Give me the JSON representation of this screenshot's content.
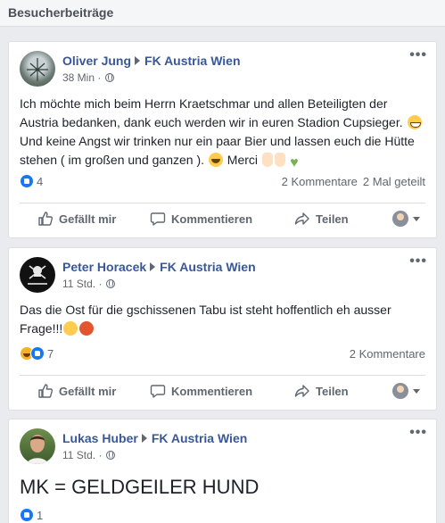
{
  "section": {
    "title": "Besucherbeiträge"
  },
  "labels": {
    "like": "Gefällt mir",
    "comment": "Kommentieren",
    "share": "Teilen",
    "more": "•••"
  },
  "posts": [
    {
      "author": "Oliver Jung",
      "target": "FK Austria Wien",
      "time": "38 Min",
      "time_sep": "·",
      "text": [
        "Ich möchte mich beim Herrn Kraetschmar und allen Beteiligten der Austria bedanken, dank euch werden wir in euren Stadion Cupsieger.",
        "Und keine Angst wir trinken nur ein paar Bier und lassen euch die Hütte stehen ( im großen und ganzen ).",
        "Merci"
      ],
      "reactions": "4",
      "comments": "2 Kommentare",
      "shares": "2 Mal geteilt"
    },
    {
      "author": "Peter Horacek",
      "target": "FK Austria Wien",
      "time": "11 Std.",
      "time_sep": "·",
      "text": [
        "Das die Ost für die gschissenen Tabu ist steht hoffentlich eh ausser Frage!!!"
      ],
      "reactions": "7",
      "comments": "2 Kommentare"
    },
    {
      "author": "Lukas Huber",
      "target": "FK Austria Wien",
      "time": "11 Std.",
      "time_sep": "·",
      "text": [
        "MK = GELDGEILER HUND"
      ],
      "reactions": "1"
    }
  ],
  "colors": {
    "link": "#385898",
    "like": "#1877f2",
    "bg": "#e9ebee"
  },
  "icons": [
    "globe-icon",
    "thumbs-up-icon",
    "comment-icon",
    "share-icon",
    "caret-down-icon"
  ]
}
